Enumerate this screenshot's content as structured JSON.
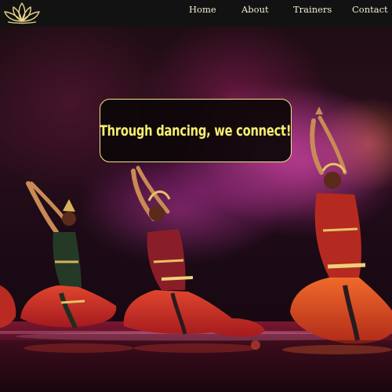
{
  "header": {
    "logo_icon": "lotus-icon",
    "nav": [
      {
        "label": "Home"
      },
      {
        "label": "About"
      },
      {
        "label": "Trainers"
      },
      {
        "label": "Contact"
      }
    ]
  },
  "hero": {
    "tagline": "Through dancing, we connect!",
    "image_subject": "dance-performance-photo"
  },
  "colors": {
    "navbar_bg": "#121212",
    "nav_text": "#f3ecd2",
    "logo": "#e8d58a",
    "tagline_text": "#f6ee72",
    "tagline_border": "#f0e48a"
  }
}
